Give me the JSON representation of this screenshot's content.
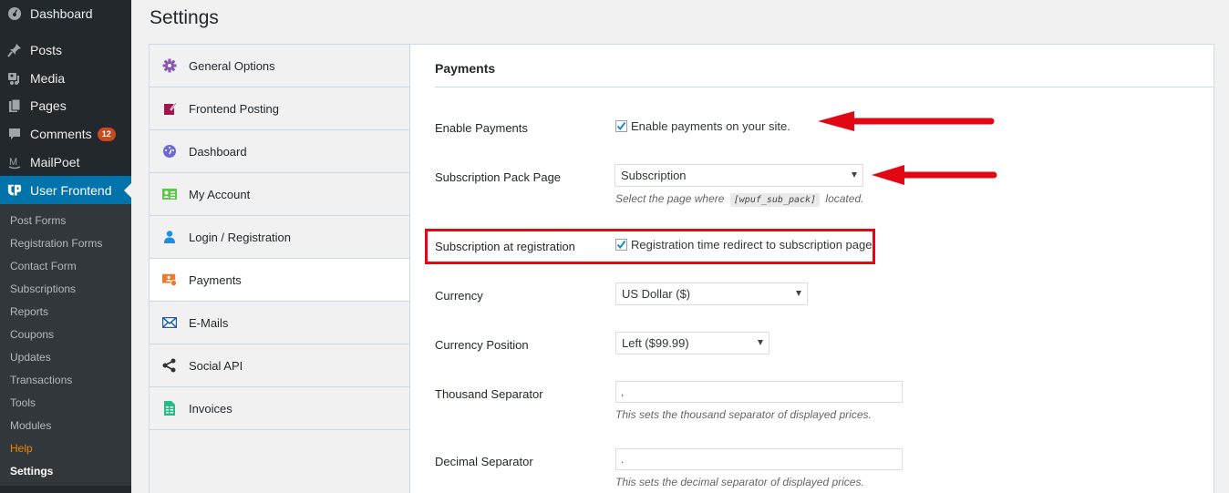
{
  "admin_menu": {
    "items": [
      {
        "label": "Dashboard",
        "icon": "dashboard-icon"
      },
      {
        "label": "Posts",
        "icon": "pin-icon"
      },
      {
        "label": "Media",
        "icon": "media-icon"
      },
      {
        "label": "Pages",
        "icon": "pages-icon"
      },
      {
        "label": "Comments",
        "icon": "comment-icon",
        "badge": "12"
      },
      {
        "label": "MailPoet",
        "icon": "mailpoet-icon"
      },
      {
        "label": "User Frontend",
        "icon": "user-frontend-icon",
        "current": true
      }
    ],
    "submenu": [
      {
        "label": "Post Forms"
      },
      {
        "label": "Registration Forms"
      },
      {
        "label": "Contact Form"
      },
      {
        "label": "Subscriptions"
      },
      {
        "label": "Reports"
      },
      {
        "label": "Coupons"
      },
      {
        "label": "Updates"
      },
      {
        "label": "Transactions"
      },
      {
        "label": "Tools"
      },
      {
        "label": "Modules"
      },
      {
        "label": "Help"
      },
      {
        "label": "Settings",
        "current": true
      }
    ]
  },
  "page": {
    "title": "Settings"
  },
  "tabs": [
    {
      "label": "General Options",
      "icon": "gear-icon",
      "color": "#8b57b4"
    },
    {
      "label": "Frontend Posting",
      "icon": "edit-post-icon",
      "color": "#a3154e"
    },
    {
      "label": "Dashboard",
      "icon": "dashboard-gauge-icon",
      "color": "#6a6ad6"
    },
    {
      "label": "My Account",
      "icon": "id-card-icon",
      "color": "#5cc84a"
    },
    {
      "label": "Login / Registration",
      "icon": "user-icon",
      "color": "#1e8fe0"
    },
    {
      "label": "Payments",
      "icon": "payment-icon",
      "color": "#ec7a2b",
      "active": true
    },
    {
      "label": "E-Mails",
      "icon": "envelope-icon",
      "color": "#1f5da8"
    },
    {
      "label": "Social API",
      "icon": "share-icon",
      "color": "#333333"
    },
    {
      "label": "Invoices",
      "icon": "invoice-icon",
      "color": "#2bb88a"
    }
  ],
  "panel": {
    "title": "Payments",
    "enable_payments": {
      "label": "Enable Payments",
      "checkbox_label": "Enable payments on your site.",
      "checked": true
    },
    "subscription_pack_page": {
      "label": "Subscription Pack Page",
      "selected": "Subscription",
      "desc_before": "Select the page where",
      "desc_code": "[wpuf_sub_pack]",
      "desc_after": "located."
    },
    "subscription_at_registration": {
      "label": "Subscription at registration",
      "checkbox_label": "Registration time redirect to subscription page",
      "checked": true
    },
    "currency": {
      "label": "Currency",
      "selected": "US Dollar ($)"
    },
    "currency_position": {
      "label": "Currency Position",
      "selected": "Left ($99.99)"
    },
    "thousand_separator": {
      "label": "Thousand Separator",
      "value": ",",
      "desc": "This sets the thousand separator of displayed prices."
    },
    "decimal_separator": {
      "label": "Decimal Separator",
      "value": ".",
      "desc": "This sets the decimal separator of displayed prices."
    }
  },
  "annotations": {
    "color": "#e30613"
  }
}
